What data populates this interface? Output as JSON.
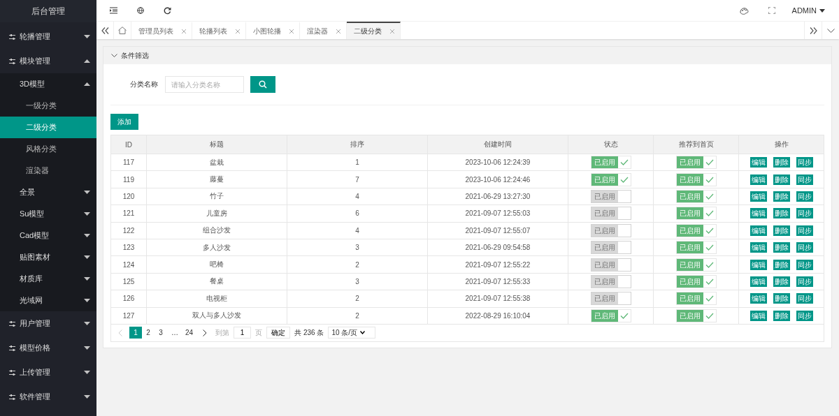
{
  "sidebar": {
    "title": "后台管理",
    "items": [
      {
        "label": "轮播管理",
        "selected": false,
        "expanded": false
      },
      {
        "label": "模块管理",
        "selected": false,
        "expanded": true,
        "children": [
          {
            "label": "3D模型",
            "selected": false,
            "expanded": true,
            "children": [
              {
                "label": "一级分类",
                "selected": false
              },
              {
                "label": "二级分类",
                "selected": true
              },
              {
                "label": "风格分类",
                "selected": false
              },
              {
                "label": "渲染器",
                "selected": false
              }
            ]
          },
          {
            "label": "全景",
            "selected": false,
            "expanded": false
          },
          {
            "label": "Su模型",
            "selected": false,
            "expanded": false
          },
          {
            "label": "Cad模型",
            "selected": false,
            "expanded": false
          },
          {
            "label": "贴图素材",
            "selected": false,
            "expanded": false
          },
          {
            "label": "材质库",
            "selected": false,
            "expanded": false
          },
          {
            "label": "光域网",
            "selected": false,
            "expanded": false
          }
        ]
      },
      {
        "label": "用户管理",
        "selected": false,
        "expanded": false
      },
      {
        "label": "模型价格",
        "selected": false,
        "expanded": false
      },
      {
        "label": "上传管理",
        "selected": false,
        "expanded": false
      },
      {
        "label": "软件管理",
        "selected": false,
        "expanded": false
      }
    ]
  },
  "topbar": {
    "user": "ADMIN"
  },
  "tabs": [
    {
      "label": "管理员列表",
      "selected": false
    },
    {
      "label": "轮播列表",
      "selected": false
    },
    {
      "label": "小图轮播",
      "selected": false
    },
    {
      "label": "渲染器",
      "selected": false
    },
    {
      "label": "二级分类",
      "selected": true
    }
  ],
  "filter": {
    "title": "条件筛选",
    "expanded": true,
    "label": "分类名称",
    "placeholder": "请输入分类名称"
  },
  "add_button": "添加",
  "table": {
    "columns": [
      "ID",
      "标题",
      "排序",
      "创建时间",
      "状态",
      "推荐到首页",
      "操作"
    ],
    "rows": [
      {
        "id": "117",
        "title": "盆栽",
        "sort": "1",
        "created": "2023-10-06 12:24:39",
        "status": {
          "label": "已启用",
          "on": true
        },
        "recommend": {
          "label": "已启用",
          "on": true
        },
        "actions": [
          "编辑",
          "删除",
          "同步"
        ]
      },
      {
        "id": "119",
        "title": "藤蔓",
        "sort": "7",
        "created": "2023-10-06 12:24:46",
        "status": {
          "label": "已启用",
          "on": true
        },
        "recommend": {
          "label": "已启用",
          "on": true
        },
        "actions": [
          "编辑",
          "删除",
          "同步"
        ]
      },
      {
        "id": "120",
        "title": "竹子",
        "sort": "4",
        "created": "2021-06-29 13:27:30",
        "status": {
          "label": "已启用",
          "on": false
        },
        "recommend": {
          "label": "已启用",
          "on": true
        },
        "actions": [
          "编辑",
          "删除",
          "同步"
        ]
      },
      {
        "id": "121",
        "title": "儿童房",
        "sort": "6",
        "created": "2021-09-07 12:55:03",
        "status": {
          "label": "已启用",
          "on": false
        },
        "recommend": {
          "label": "已启用",
          "on": true
        },
        "actions": [
          "编辑",
          "删除",
          "同步"
        ]
      },
      {
        "id": "122",
        "title": "组合沙发",
        "sort": "4",
        "created": "2021-09-07 12:55:07",
        "status": {
          "label": "已启用",
          "on": false
        },
        "recommend": {
          "label": "已启用",
          "on": true
        },
        "actions": [
          "编辑",
          "删除",
          "同步"
        ]
      },
      {
        "id": "123",
        "title": "多人沙发",
        "sort": "3",
        "created": "2021-06-29 09:54:58",
        "status": {
          "label": "已启用",
          "on": false
        },
        "recommend": {
          "label": "已启用",
          "on": true
        },
        "actions": [
          "编辑",
          "删除",
          "同步"
        ]
      },
      {
        "id": "124",
        "title": "吧椅",
        "sort": "2",
        "created": "2021-09-07 12:55:22",
        "status": {
          "label": "已启用",
          "on": false
        },
        "recommend": {
          "label": "已启用",
          "on": true
        },
        "actions": [
          "编辑",
          "删除",
          "同步"
        ]
      },
      {
        "id": "125",
        "title": "餐桌",
        "sort": "3",
        "created": "2021-09-07 12:55:33",
        "status": {
          "label": "已启用",
          "on": false
        },
        "recommend": {
          "label": "已启用",
          "on": true
        },
        "actions": [
          "编辑",
          "删除",
          "同步"
        ]
      },
      {
        "id": "126",
        "title": "电视柜",
        "sort": "2",
        "created": "2021-09-07 12:55:38",
        "status": {
          "label": "已启用",
          "on": false
        },
        "recommend": {
          "label": "已启用",
          "on": true
        },
        "actions": [
          "编辑",
          "删除",
          "同步"
        ]
      },
      {
        "id": "127",
        "title": "双人与多人沙发",
        "sort": "2",
        "created": "2022-08-29 16:10:04",
        "status": {
          "label": "已启用",
          "on": true
        },
        "recommend": {
          "label": "已启用",
          "on": true
        },
        "actions": [
          "编辑",
          "删除",
          "同步"
        ]
      }
    ]
  },
  "pagination": {
    "pages": [
      {
        "label": "1",
        "selected": true
      },
      {
        "label": "2",
        "selected": false
      },
      {
        "label": "3",
        "selected": false
      }
    ],
    "ellipsis": "…",
    "last": "24",
    "goto_label": "到第",
    "goto_value": "1",
    "page_unit": "页",
    "confirm": "确定",
    "total": "共 236 条",
    "page_size": "10 条/页"
  }
}
